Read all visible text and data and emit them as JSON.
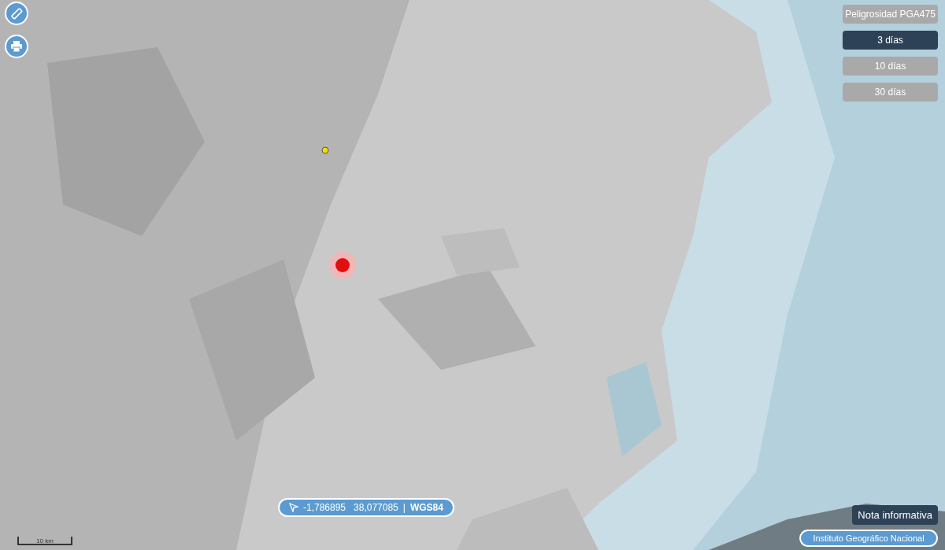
{
  "tools": [
    {
      "kind": "ruler"
    },
    {
      "kind": "print"
    }
  ],
  "layers": [
    {
      "label": "Peligrosidad PGA475",
      "selected": false
    },
    {
      "label": "3 días",
      "selected": true
    },
    {
      "label": "10 días",
      "selected": false
    },
    {
      "label": "30 días",
      "selected": false
    }
  ],
  "coordinates": {
    "longitude": "-1,786895",
    "latitude": "38,077085",
    "separator": "|",
    "system": "WGS84"
  },
  "scale": {
    "label": "10 km"
  },
  "info_button": "Nota informativa",
  "attribution": "Instituto Geográfico Nacional"
}
